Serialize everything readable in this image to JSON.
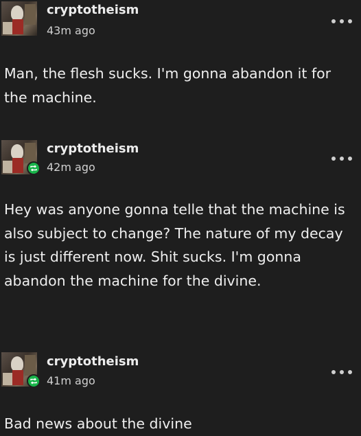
{
  "posts": [
    {
      "username": "cryptotheism",
      "time": "43m ago",
      "text": "Man, the flesh sucks. I'm gonna abandon it for the machine.",
      "reblog_badge": false,
      "more_icon": "ellipsis-icon"
    },
    {
      "username": "cryptotheism",
      "time": "42m ago",
      "text": "Hey was anyone gonna telle that the machine is also subject to change? The nature of my decay is just different now. Shit sucks. I'm gonna abandon the machine for the divine.",
      "reblog_badge": true,
      "more_icon": "ellipsis-icon"
    },
    {
      "username": "cryptotheism",
      "time": "41m ago",
      "text": "Bad news about the divine",
      "reblog_badge": true,
      "more_icon": "ellipsis-icon"
    }
  ],
  "colors": {
    "background": "#1e1e1e",
    "text": "#efefef",
    "badge": "#19b44a"
  }
}
